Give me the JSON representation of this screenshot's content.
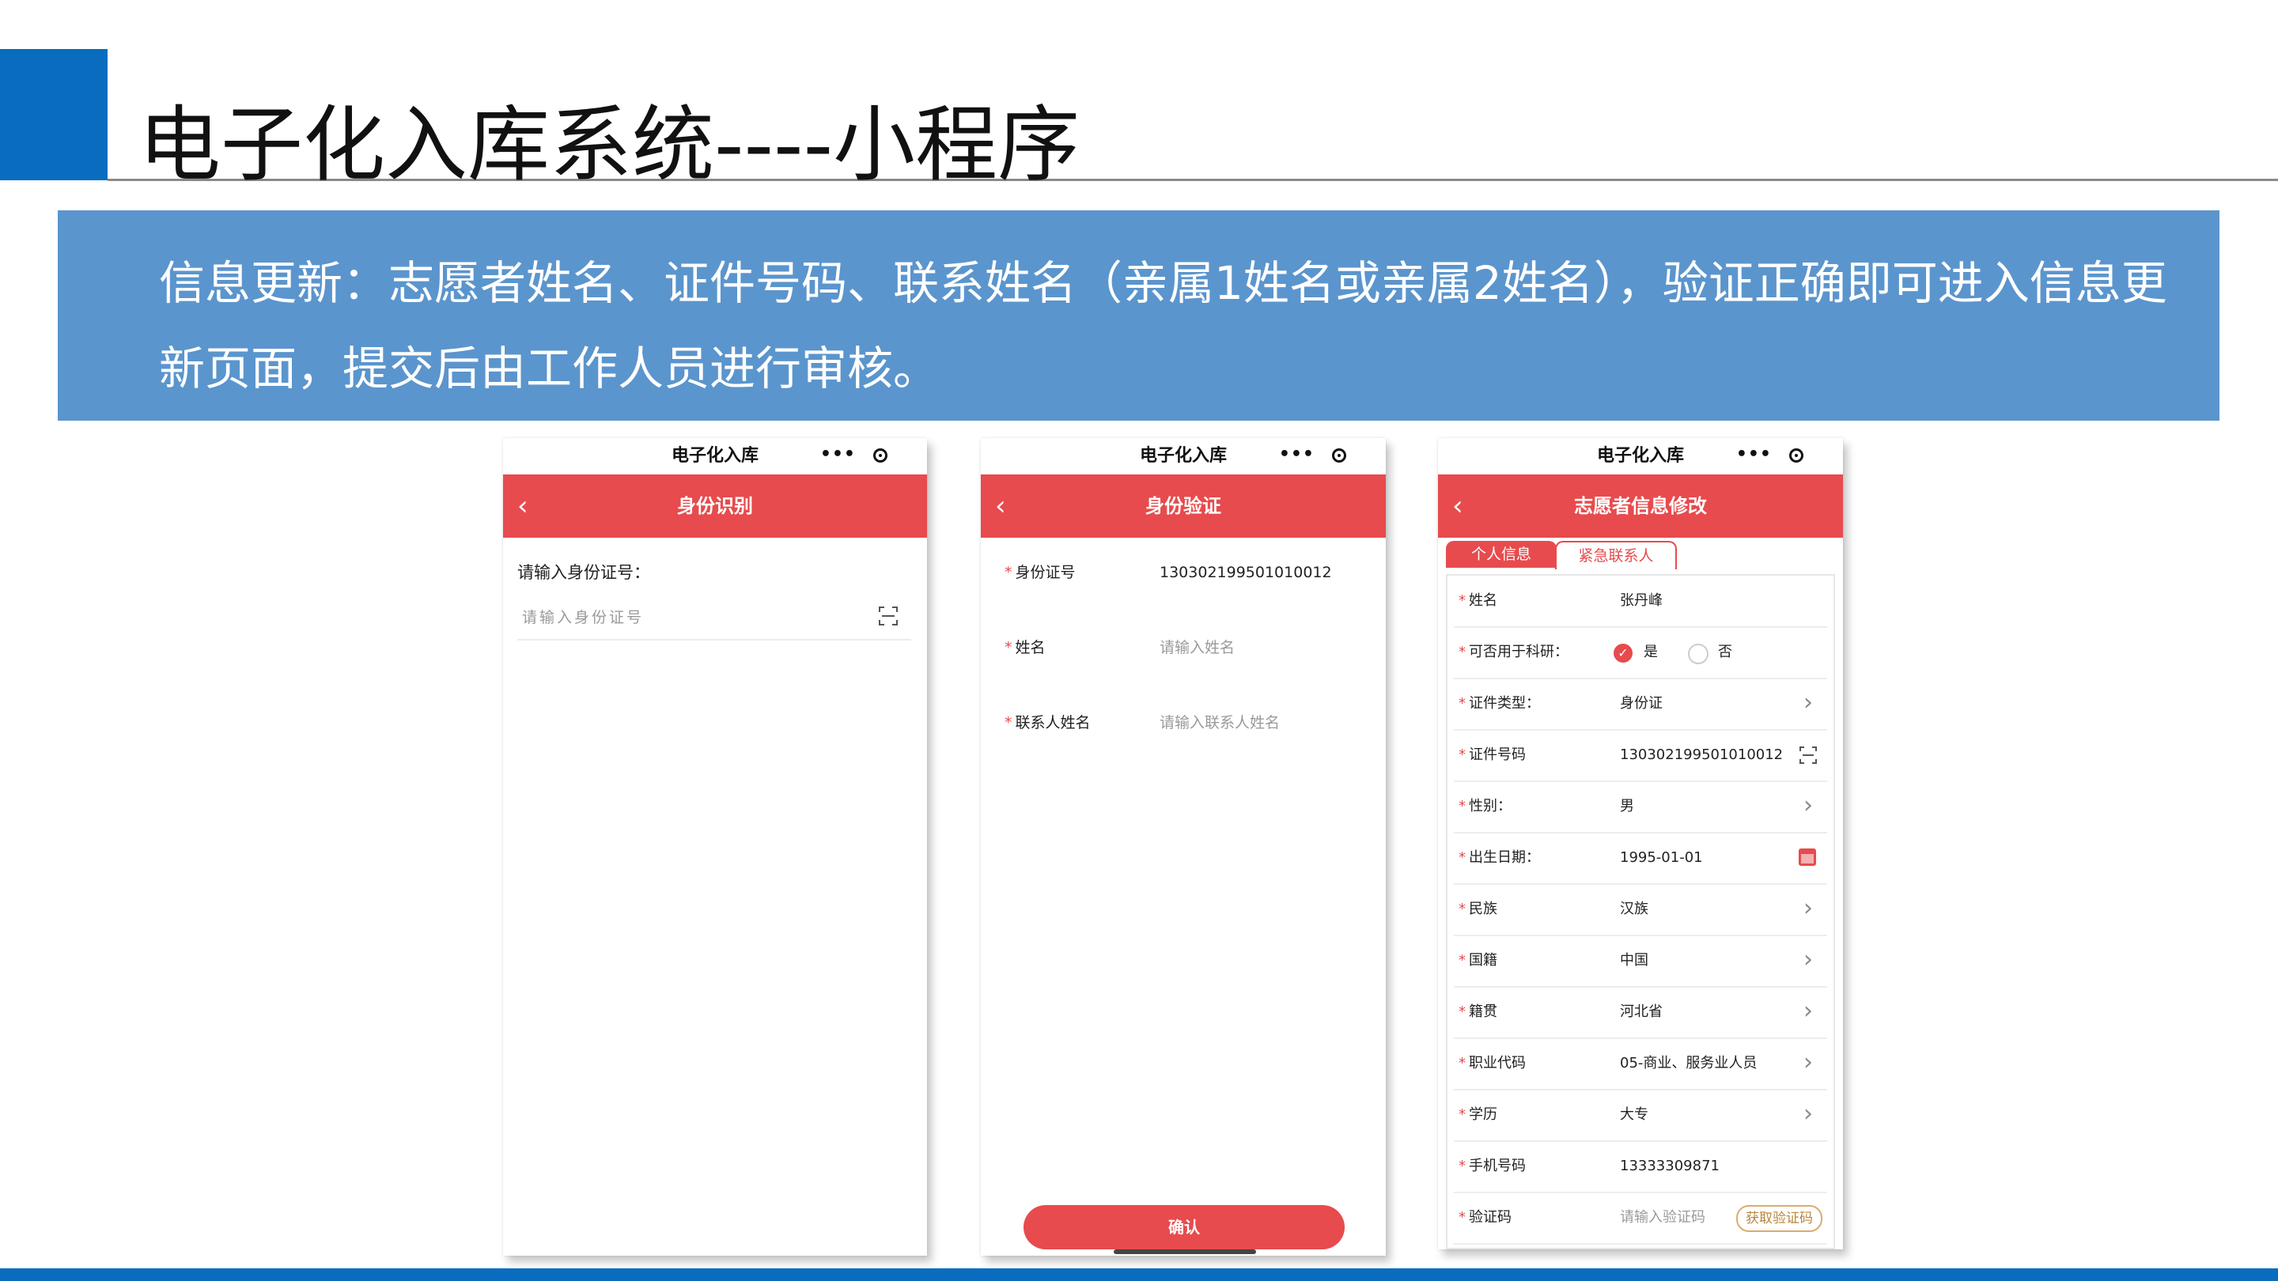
{
  "slide": {
    "title": "电子化入库系统----小程序",
    "description": "信息更新：志愿者姓名、证件号码、联系姓名（亲属1姓名或亲属2姓名），验证正确即可进入信息更新页面，提交后由工作人员进行审核。"
  },
  "mini_program": {
    "title": "电子化入库",
    "more_icon": "•••"
  },
  "screen1": {
    "nav_title": "身份识别",
    "id_label": "请输入身份证号：",
    "id_placeholder": "请输入身份证号"
  },
  "screen2": {
    "nav_title": "身份验证",
    "fields": [
      {
        "label": "身份证号",
        "value": "130302199501010012"
      },
      {
        "label": "姓名",
        "placeholder": "请输入姓名"
      },
      {
        "label": "联系人姓名",
        "placeholder": "请输入联系人姓名"
      }
    ],
    "confirm": "确认"
  },
  "screen3": {
    "nav_title": "志愿者信息修改",
    "tabs": [
      "个人信息",
      "紧急联系人"
    ],
    "rows": [
      {
        "label": "姓名",
        "value": "张丹峰"
      },
      {
        "label": "可否用于科研：",
        "yes": "是",
        "no": "否"
      },
      {
        "label": "证件类型：",
        "value": "身份证"
      },
      {
        "label": "证件号码",
        "value": "130302199501010012"
      },
      {
        "label": "性别：",
        "value": "男"
      },
      {
        "label": "出生日期：",
        "value": "1995-01-01"
      },
      {
        "label": "民族",
        "value": "汉族"
      },
      {
        "label": "国籍",
        "value": "中国"
      },
      {
        "label": "籍贯",
        "value": "河北省"
      },
      {
        "label": "职业代码",
        "value": "05-商业、服务业人员"
      },
      {
        "label": "学历",
        "value": "大专"
      },
      {
        "label": "手机号码",
        "value": "13333309871"
      },
      {
        "label": "验证码",
        "placeholder": "请输入验证码",
        "button": "获取验证码"
      }
    ]
  },
  "colors": {
    "brand_red": "#e74b4d",
    "slide_blue": "#0a6cbf",
    "banner_blue": "#5b95cd"
  }
}
